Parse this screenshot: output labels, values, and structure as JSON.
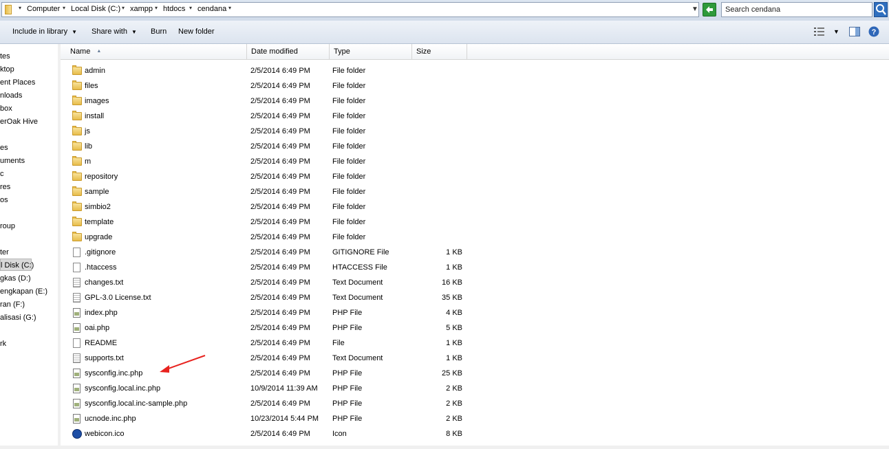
{
  "address": {
    "segments": [
      "Computer",
      "Local Disk (C:)",
      "xampp",
      "htdocs",
      "cendana"
    ]
  },
  "search": {
    "placeholder": "Search cendana"
  },
  "toolbar": {
    "include_label": "Include in library",
    "share_label": "Share with",
    "burn_label": "Burn",
    "newfolder_label": "New folder"
  },
  "nav": {
    "items": [
      "tes",
      "ktop",
      "ent Places",
      "nloads",
      "box",
      "erOak Hive",
      "es",
      "uments",
      "c",
      "res",
      "os",
      "roup",
      "ter",
      "l Disk (C:)",
      "gkas (D:)",
      "engkapan (E:)",
      "ran (F:)",
      "alisasi (G:)",
      "rk"
    ]
  },
  "columns": {
    "name": "Name",
    "date": "Date modified",
    "type": "Type",
    "size": "Size"
  },
  "files": [
    {
      "name": "admin",
      "date": "2/5/2014 6:49 PM",
      "type": "File folder",
      "size": "",
      "icon": "folder"
    },
    {
      "name": "files",
      "date": "2/5/2014 6:49 PM",
      "type": "File folder",
      "size": "",
      "icon": "folder"
    },
    {
      "name": "images",
      "date": "2/5/2014 6:49 PM",
      "type": "File folder",
      "size": "",
      "icon": "folder"
    },
    {
      "name": "install",
      "date": "2/5/2014 6:49 PM",
      "type": "File folder",
      "size": "",
      "icon": "folder"
    },
    {
      "name": "js",
      "date": "2/5/2014 6:49 PM",
      "type": "File folder",
      "size": "",
      "icon": "folder"
    },
    {
      "name": "lib",
      "date": "2/5/2014 6:49 PM",
      "type": "File folder",
      "size": "",
      "icon": "folder"
    },
    {
      "name": "m",
      "date": "2/5/2014 6:49 PM",
      "type": "File folder",
      "size": "",
      "icon": "folder"
    },
    {
      "name": "repository",
      "date": "2/5/2014 6:49 PM",
      "type": "File folder",
      "size": "",
      "icon": "folder"
    },
    {
      "name": "sample",
      "date": "2/5/2014 6:49 PM",
      "type": "File folder",
      "size": "",
      "icon": "folder"
    },
    {
      "name": "simbio2",
      "date": "2/5/2014 6:49 PM",
      "type": "File folder",
      "size": "",
      "icon": "folder"
    },
    {
      "name": "template",
      "date": "2/5/2014 6:49 PM",
      "type": "File folder",
      "size": "",
      "icon": "folder"
    },
    {
      "name": "upgrade",
      "date": "2/5/2014 6:49 PM",
      "type": "File folder",
      "size": "",
      "icon": "folder"
    },
    {
      "name": ".gitignore",
      "date": "2/5/2014 6:49 PM",
      "type": "GITIGNORE File",
      "size": "1 KB",
      "icon": "file"
    },
    {
      "name": ".htaccess",
      "date": "2/5/2014 6:49 PM",
      "type": "HTACCESS File",
      "size": "1 KB",
      "icon": "file"
    },
    {
      "name": "changes.txt",
      "date": "2/5/2014 6:49 PM",
      "type": "Text Document",
      "size": "16 KB",
      "icon": "txt"
    },
    {
      "name": "GPL-3.0 License.txt",
      "date": "2/5/2014 6:49 PM",
      "type": "Text Document",
      "size": "35 KB",
      "icon": "txt"
    },
    {
      "name": "index.php",
      "date": "2/5/2014 6:49 PM",
      "type": "PHP File",
      "size": "4 KB",
      "icon": "php"
    },
    {
      "name": "oai.php",
      "date": "2/5/2014 6:49 PM",
      "type": "PHP File",
      "size": "5 KB",
      "icon": "php"
    },
    {
      "name": "README",
      "date": "2/5/2014 6:49 PM",
      "type": "File",
      "size": "1 KB",
      "icon": "file"
    },
    {
      "name": "supports.txt",
      "date": "2/5/2014 6:49 PM",
      "type": "Text Document",
      "size": "1 KB",
      "icon": "txt"
    },
    {
      "name": "sysconfig.inc.php",
      "date": "2/5/2014 6:49 PM",
      "type": "PHP File",
      "size": "25 KB",
      "icon": "php"
    },
    {
      "name": "sysconfig.local.inc.php",
      "date": "10/9/2014 11:39 AM",
      "type": "PHP File",
      "size": "2 KB",
      "icon": "php"
    },
    {
      "name": "sysconfig.local.inc-sample.php",
      "date": "2/5/2014 6:49 PM",
      "type": "PHP File",
      "size": "2 KB",
      "icon": "php"
    },
    {
      "name": "ucnode.inc.php",
      "date": "10/23/2014 5:44 PM",
      "type": "PHP File",
      "size": "2 KB",
      "icon": "php"
    },
    {
      "name": "webicon.ico",
      "date": "2/5/2014 6:49 PM",
      "type": "Icon",
      "size": "8 KB",
      "icon": "ico"
    }
  ],
  "annotation": {
    "color": "#e8231f"
  }
}
